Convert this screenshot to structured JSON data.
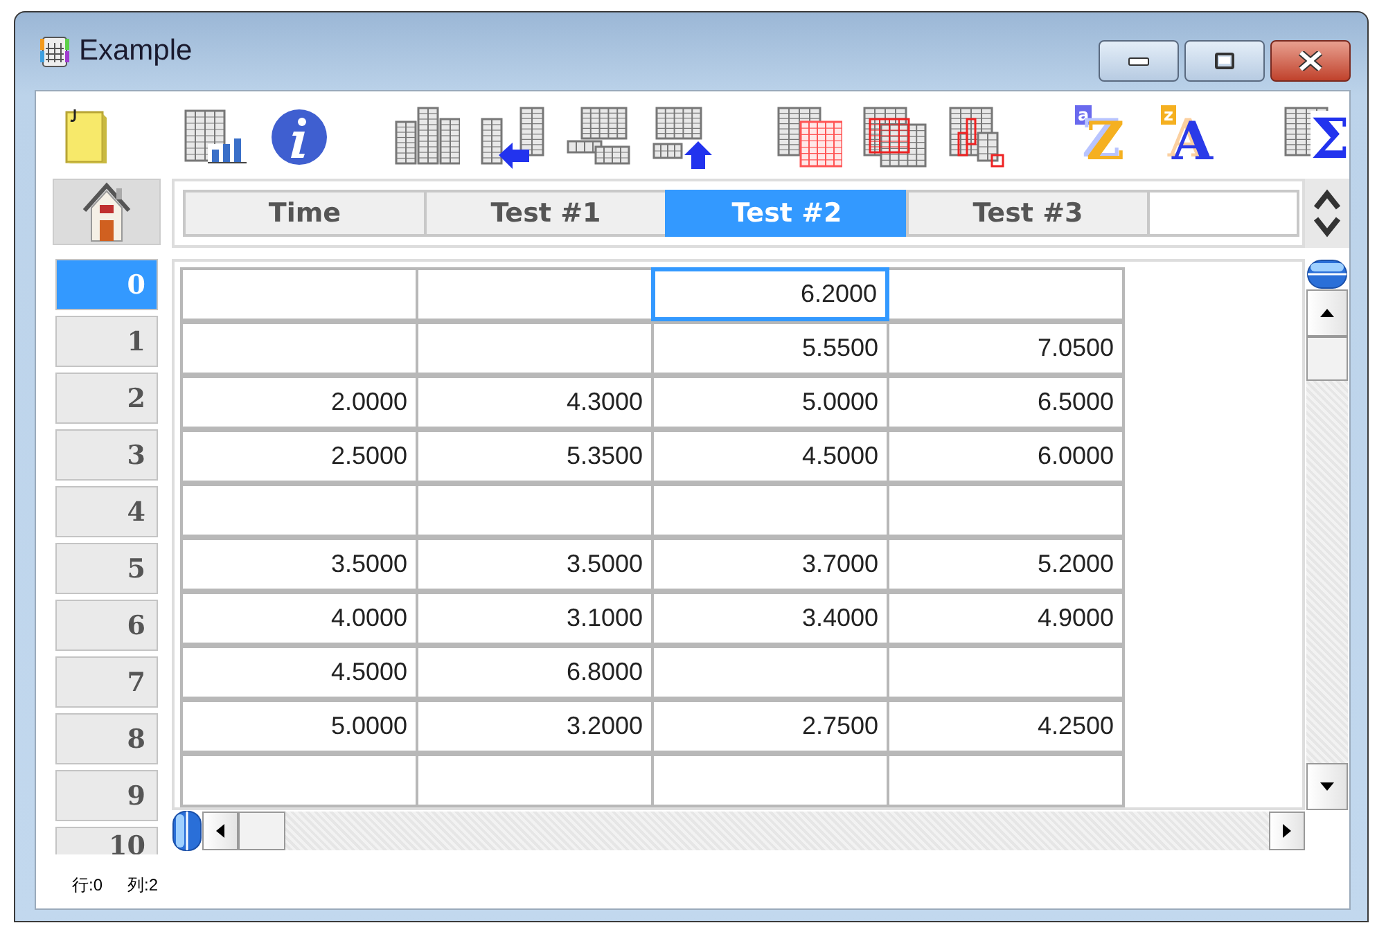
{
  "window": {
    "title": "Example"
  },
  "toolbar": [
    [
      {
        "kind": "note"
      }
    ],
    [
      {
        "kind": "chart"
      },
      {
        "kind": "info"
      }
    ],
    [
      {
        "kind": "columns"
      },
      {
        "kind": "insert-left"
      },
      {
        "kind": "rows"
      },
      {
        "kind": "insert-up"
      }
    ],
    [
      {
        "kind": "grid-overlay"
      },
      {
        "kind": "grid-stack"
      },
      {
        "kind": "grid-scatter"
      }
    ],
    [
      {
        "kind": "sort-asc",
        "glyph": "Z",
        "small": "a"
      },
      {
        "kind": "sort-desc",
        "glyph": "A",
        "small": "z"
      }
    ],
    [
      {
        "kind": "sum",
        "glyph": "Σ"
      }
    ]
  ],
  "table": {
    "columns": [
      {
        "label": "Time",
        "selected": false
      },
      {
        "label": "Test #1",
        "selected": false
      },
      {
        "label": "Test #2",
        "selected": true
      },
      {
        "label": "Test #3",
        "selected": false
      },
      {
        "selected": false
      }
    ],
    "rows": [
      {
        "header": "0",
        "selected": true,
        "cells": [
          "",
          "",
          "6.2000",
          ""
        ]
      },
      {
        "header": "1",
        "selected": false,
        "cells": [
          "",
          "",
          "5.5500",
          "7.0500"
        ]
      },
      {
        "header": "2",
        "selected": false,
        "cells": [
          "2.0000",
          "4.3000",
          "5.0000",
          "6.5000"
        ]
      },
      {
        "header": "3",
        "selected": false,
        "cells": [
          "2.5000",
          "5.3500",
          "4.5000",
          "6.0000"
        ]
      },
      {
        "header": "4",
        "selected": false,
        "cells": [
          "",
          "",
          "",
          ""
        ]
      },
      {
        "header": "5",
        "selected": false,
        "cells": [
          "3.5000",
          "3.5000",
          "3.7000",
          "5.2000"
        ]
      },
      {
        "header": "6",
        "selected": false,
        "cells": [
          "4.0000",
          "3.1000",
          "3.4000",
          "4.9000"
        ]
      },
      {
        "header": "7",
        "selected": false,
        "cells": [
          "4.5000",
          "6.8000",
          "",
          ""
        ]
      },
      {
        "header": "8",
        "selected": false,
        "cells": [
          "5.0000",
          "3.2000",
          "2.7500",
          "4.2500"
        ]
      },
      {
        "header": "9",
        "selected": false,
        "cells": [
          "",
          "",
          "",
          ""
        ]
      },
      {
        "header": "10",
        "selected": false
      }
    ]
  },
  "status_bar": {
    "row": "行:0",
    "column": "列:2"
  }
}
